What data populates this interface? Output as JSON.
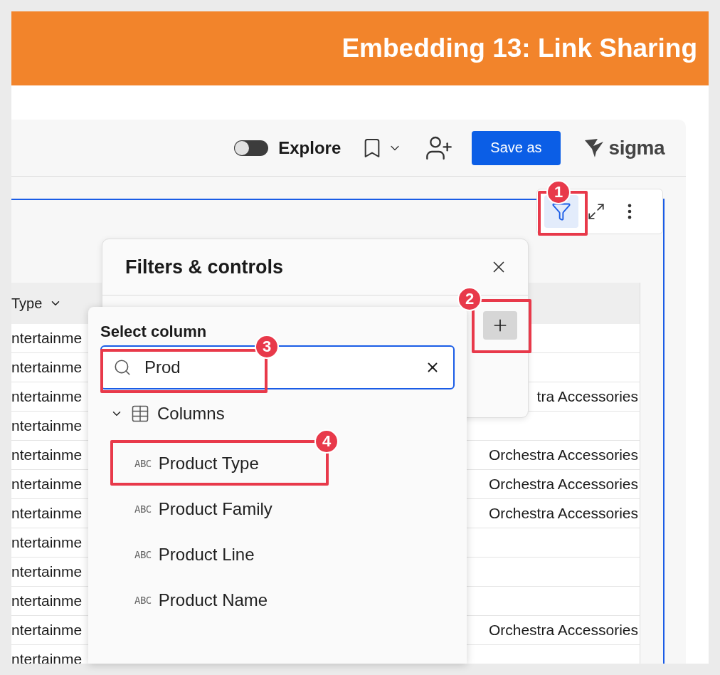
{
  "header": {
    "title": "Embedding 13: Link Sharing"
  },
  "topbar": {
    "explore_toggle": {
      "label": "Explore",
      "on": false
    },
    "save_button": "Save as",
    "logo": "sigma"
  },
  "element_toolbar": {
    "filter_active": true
  },
  "table": {
    "columns": [
      "Type"
    ],
    "rows": [
      {
        "column_1": "ntertainme"
      },
      {
        "column_1": "ntertainme"
      },
      {
        "column_1": "ntertainme",
        "column_2": "tra Accessories"
      },
      {
        "column_1": "ntertainme"
      },
      {
        "column_1": "ntertainme",
        "column_2": "Orchestra Accessories"
      },
      {
        "column_1": "ntertainme",
        "column_2": "Orchestra Accessories"
      },
      {
        "column_1": "ntertainme",
        "column_2": "Orchestra Accessories"
      },
      {
        "column_1": "ntertainme"
      },
      {
        "column_1": "ntertainme"
      },
      {
        "column_1": "ntertainme"
      },
      {
        "column_1": "ntertainme",
        "column_2": "Orchestra Accessories"
      },
      {
        "column_1": "ntertainme"
      }
    ]
  },
  "filters_panel": {
    "title": "Filters & controls"
  },
  "column_picker": {
    "title": "Select column",
    "search": {
      "value": "Prod"
    },
    "group": {
      "label": "Columns",
      "expanded": true,
      "children": [
        {
          "type": "ABC",
          "label": "Product Type"
        },
        {
          "type": "ABC",
          "label": "Product Family"
        },
        {
          "type": "ABC",
          "label": "Product Line"
        },
        {
          "type": "ABC",
          "label": "Product Name"
        }
      ]
    }
  },
  "callouts": [
    {
      "number": "1"
    },
    {
      "number": "2"
    },
    {
      "number": "3"
    },
    {
      "number": "4"
    }
  ]
}
